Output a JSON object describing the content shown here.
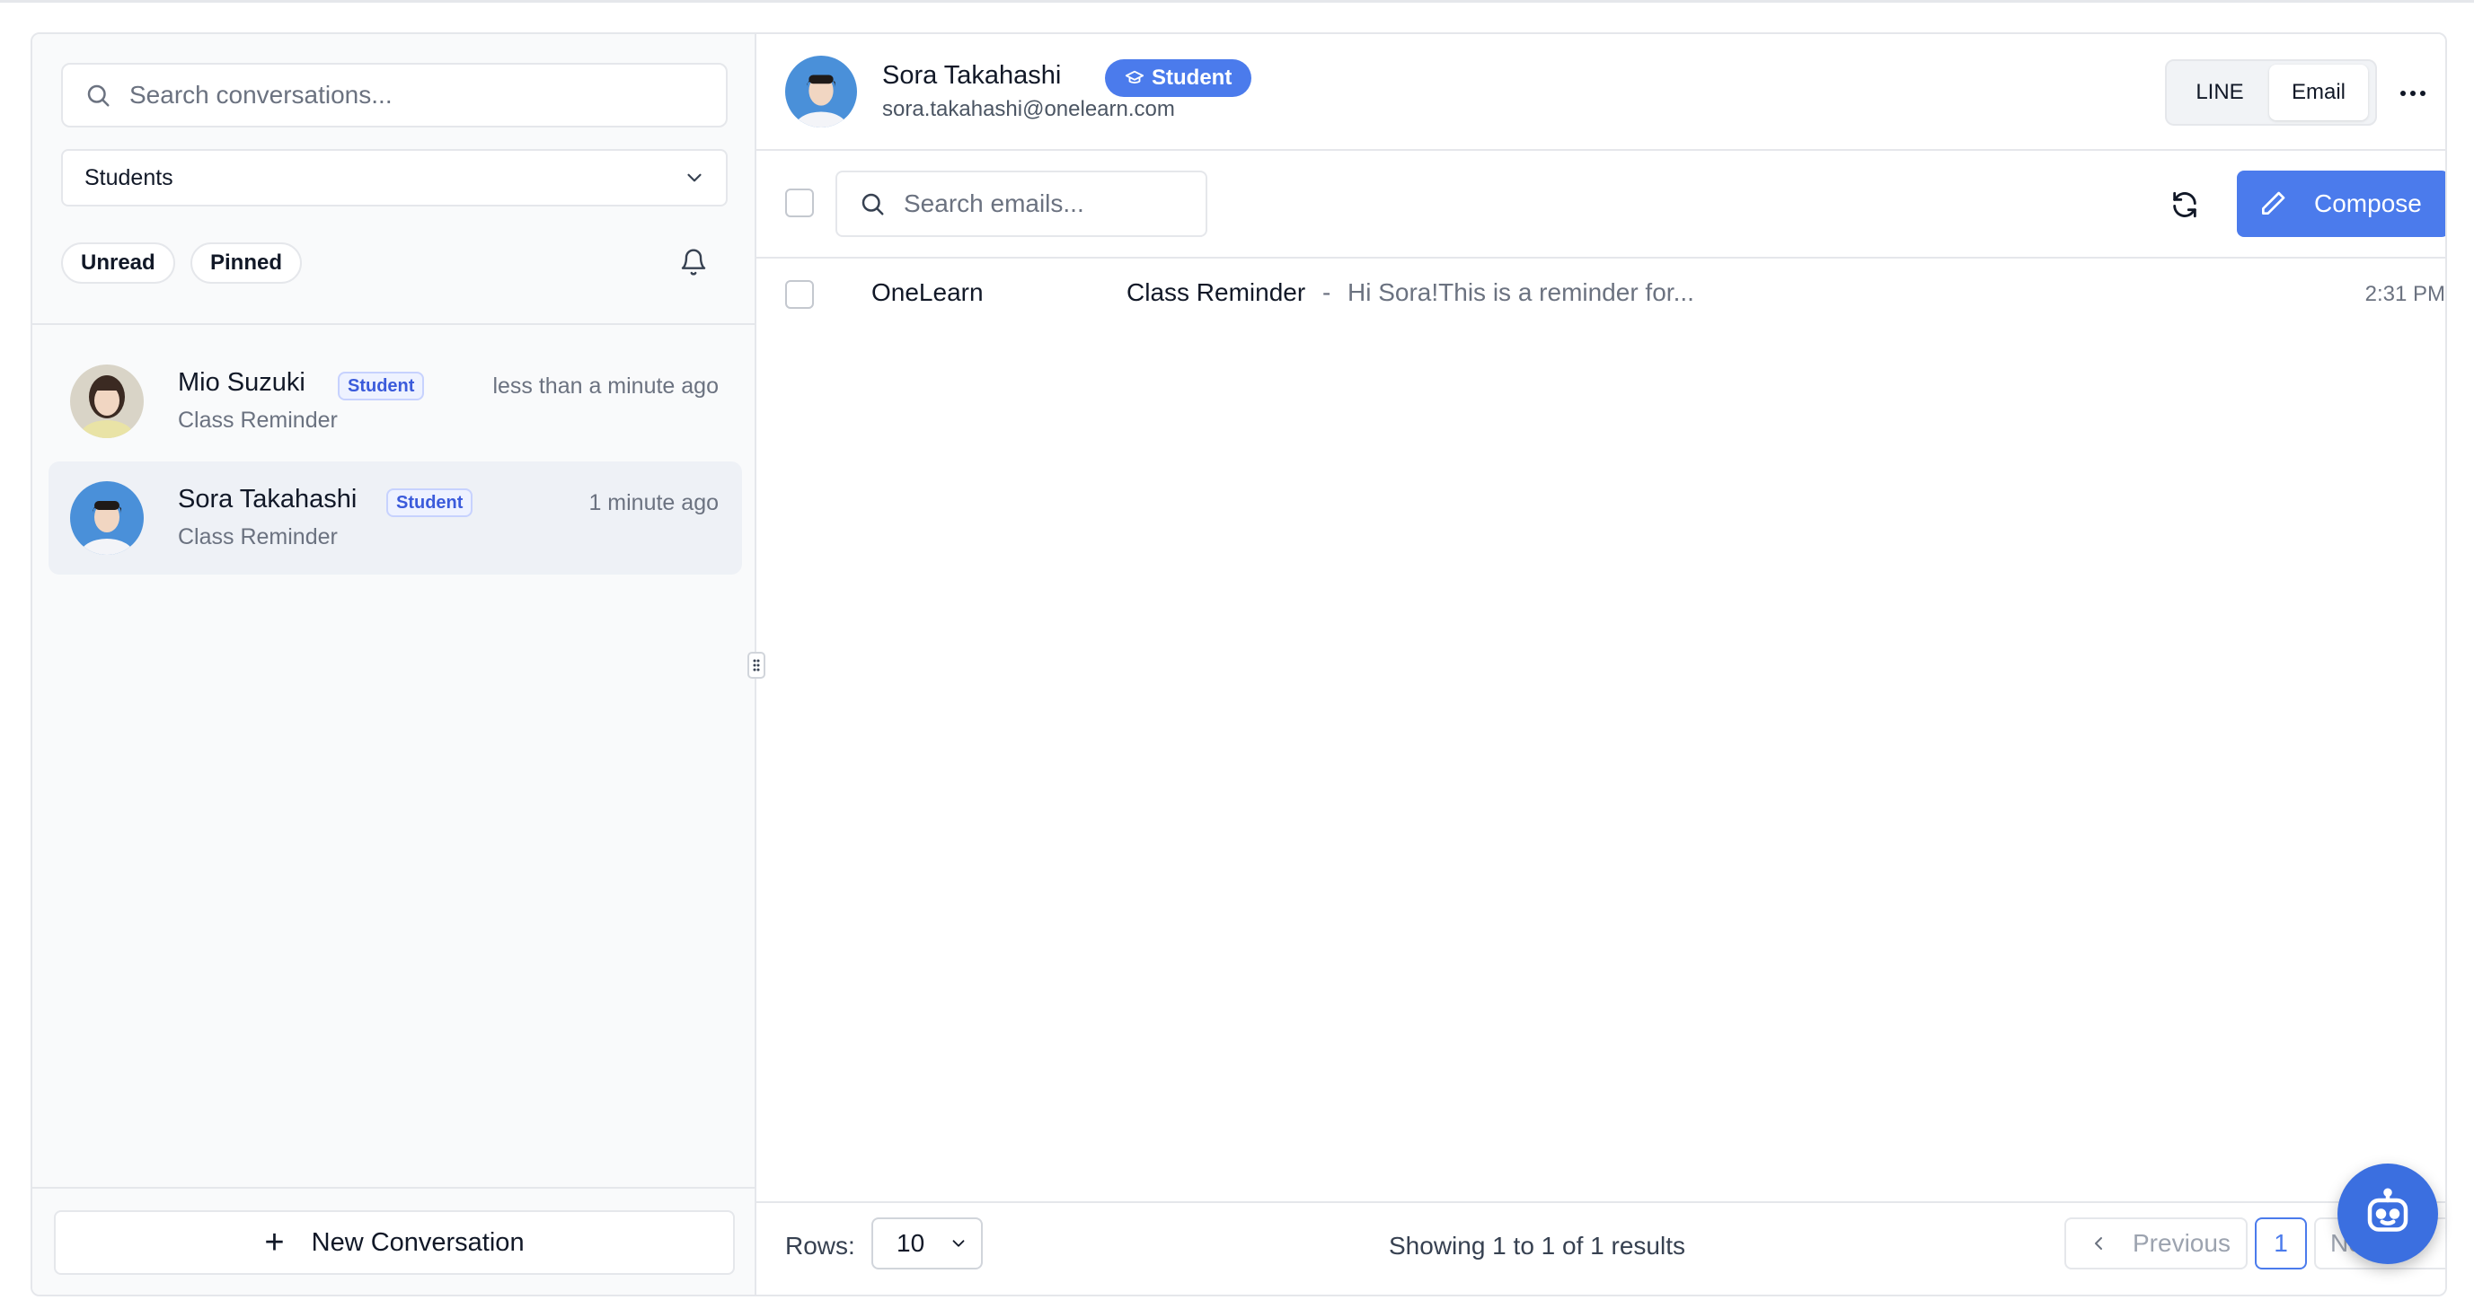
{
  "sidebar": {
    "search_placeholder": "Search conversations...",
    "filter_value": "Students",
    "chips": [
      "Unread",
      "Pinned"
    ],
    "conversations": [
      {
        "name": "Mio Suzuki",
        "badge": "Student",
        "time": "less than a minute ago",
        "subtitle": "Class Reminder",
        "active": false
      },
      {
        "name": "Sora Takahashi",
        "badge": "Student",
        "time": "1 minute ago",
        "subtitle": "Class Reminder",
        "active": true
      }
    ],
    "new_conversation_label": "New Conversation"
  },
  "header": {
    "name": "Sora Takahashi",
    "badge": "Student",
    "email": "sora.takahashi@onelearn.com",
    "channels": [
      "LINE",
      "Email"
    ],
    "selected_channel": "Email",
    "more": "···"
  },
  "toolbar": {
    "search_placeholder": "Search emails...",
    "compose_label": "Compose"
  },
  "emails": [
    {
      "from": "OneLearn",
      "subject": "Class Reminder",
      "separator": "-",
      "preview": "Hi Sora!This is a reminder for...",
      "time": "2:31 PM"
    }
  ],
  "footer": {
    "rows_label": "Rows:",
    "rows_value": "10",
    "showing_text": "Showing 1 to 1 of 1 results",
    "previous_label": "Previous",
    "page": "1",
    "next_label": "Next"
  },
  "colors": {
    "accent": "#4b7bec",
    "badge_outline": "#3b5bdb",
    "bot": "#3b6fe0"
  }
}
